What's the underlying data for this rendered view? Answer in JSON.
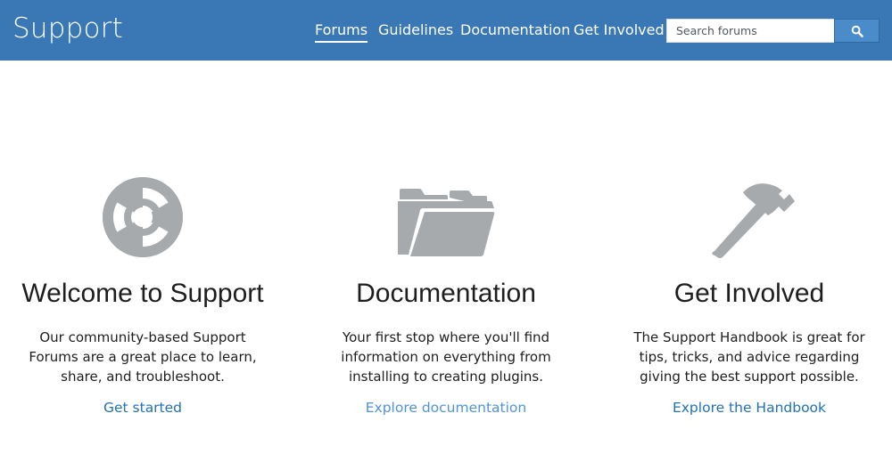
{
  "header": {
    "site_title": "Support",
    "nav": [
      {
        "label": "Forums",
        "active": true
      },
      {
        "label": "Guidelines",
        "active": false
      },
      {
        "label": "Documentation",
        "active": false
      },
      {
        "label": "Get Involved",
        "active": false
      }
    ],
    "search": {
      "placeholder": "Search forums",
      "value": "",
      "button_icon": "search-icon"
    }
  },
  "columns": [
    {
      "icon": "lifebuoy-icon",
      "title": "Welcome to Support",
      "text": "Our community-based Support Forums are a great place to learn, share, and troubleshoot.",
      "link": "Get started"
    },
    {
      "icon": "folder-open-icon",
      "title": "Documentation",
      "text": "Your first stop where you'll find information on everything from installing to creating plugins.",
      "link": "Explore documentation"
    },
    {
      "icon": "hammer-icon",
      "title": "Get Involved",
      "text": "The Support Handbook is great for tips, tricks, and advice regarding giving the best support possible.",
      "link": "Explore the Handbook"
    }
  ],
  "colors": {
    "header_bg": "#3a78b5",
    "icon_gray": "#a7aaad",
    "link": "#2271b1"
  }
}
